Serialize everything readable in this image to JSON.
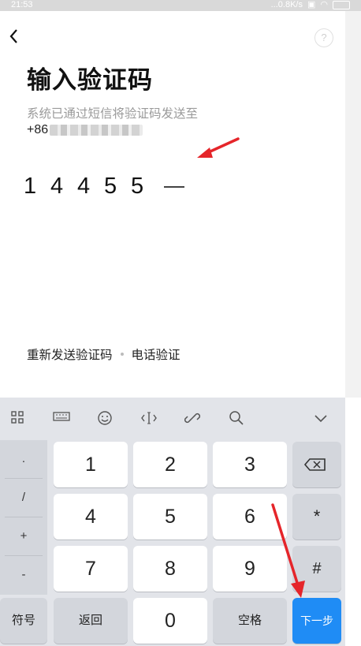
{
  "status_bar": {
    "time": "21:53",
    "network": "...0.8K/s"
  },
  "header": {
    "help_glyph": "?"
  },
  "title": "输入验证码",
  "description": "系统已通过短信将验证码发送至",
  "phone_prefix": "+86",
  "code_digits": [
    "1",
    "4",
    "4",
    "5",
    "5"
  ],
  "links": {
    "resend": "重新发送验证码",
    "voice": "电话验证"
  },
  "keyboard": {
    "toolbar_icons": [
      "grid-icon",
      "keyboard-icon",
      "emoji-icon",
      "cursor-icon",
      "link-icon",
      "search-icon",
      "collapse-icon"
    ],
    "symbols": [
      ".",
      "/",
      "+",
      "-"
    ],
    "digits": [
      "1",
      "2",
      "3",
      "4",
      "5",
      "6",
      "7",
      "8",
      "9",
      "0"
    ],
    "star": "*",
    "hash": "#",
    "fuhao": "符号",
    "back": "返回",
    "space": "空格",
    "next": "下一步"
  },
  "colors": {
    "accent": "#1f8cf5",
    "arrow": "#e5252a",
    "keyboard_bg": "#e2e4e9"
  }
}
